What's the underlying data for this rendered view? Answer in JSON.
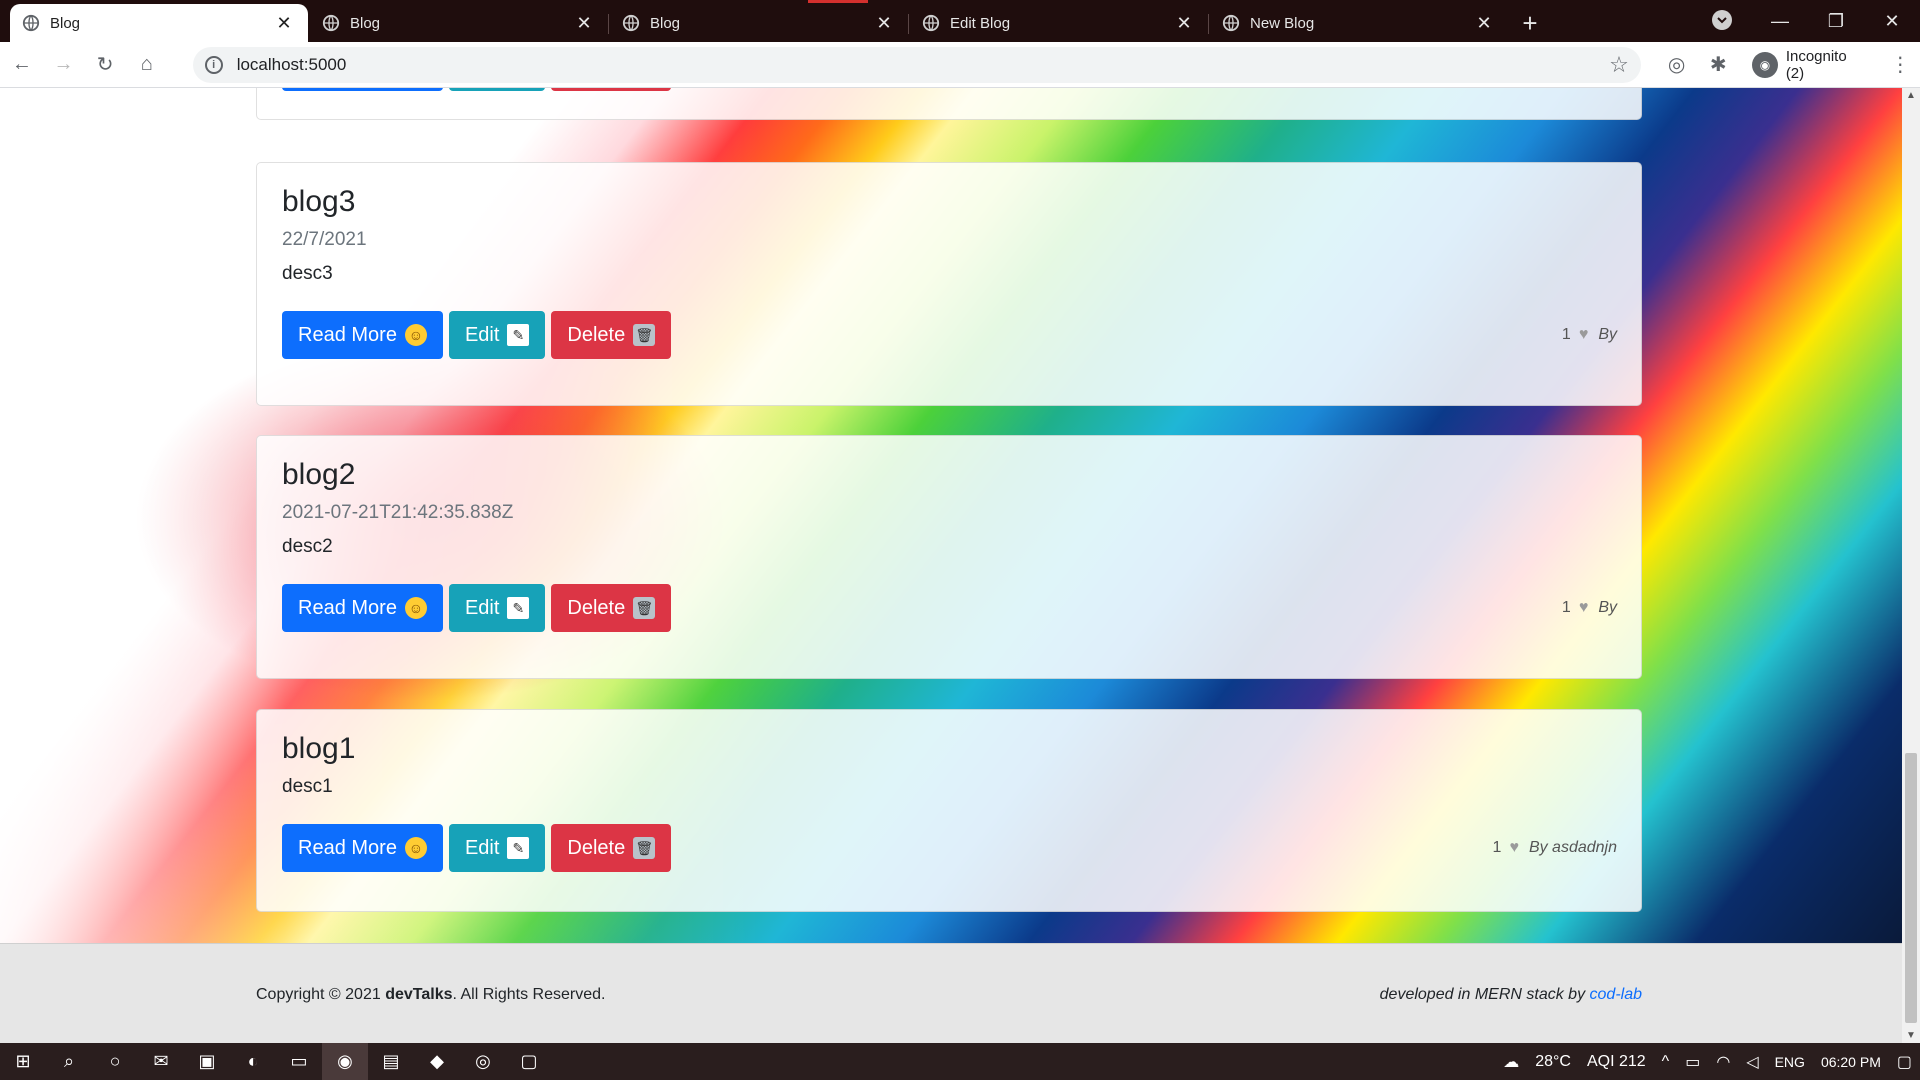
{
  "browser": {
    "tabs": [
      {
        "title": "Blog",
        "active": true
      },
      {
        "title": "Blog",
        "active": false
      },
      {
        "title": "Blog",
        "active": false
      },
      {
        "title": "Edit Blog",
        "active": false
      },
      {
        "title": "New Blog",
        "active": false
      }
    ],
    "new_tab_label": "+",
    "url": "localhost:5000",
    "incognito_label": "Incognito (2)"
  },
  "posts": [
    {
      "title": "blog3",
      "date": "22/7/2021",
      "desc": "desc3",
      "likes": "1",
      "by": "By"
    },
    {
      "title": "blog2",
      "date": "2021-07-21T21:42:35.838Z",
      "desc": "desc2",
      "likes": "1",
      "by": "By"
    },
    {
      "title": "blog1",
      "date": "",
      "desc": "desc1",
      "likes": "1",
      "by": "By asdadnjn"
    }
  ],
  "buttons": {
    "read_more": "Read More",
    "edit": "Edit",
    "delete": "Delete"
  },
  "footer": {
    "copyright_prefix": "Copyright © 2021 ",
    "brand": "devTalks",
    "copyright_suffix": ". All Rights Reserved.",
    "dev_prefix": "developed in MERN stack by ",
    "dev_link": "cod-lab"
  },
  "taskbar": {
    "weather": "28°C",
    "aqi": "AQI 212",
    "lang": "ENG",
    "time": "06:20 PM"
  },
  "colors": {
    "read_more": "#0d6efd",
    "edit": "#17a2b8",
    "delete": "#dc3545"
  }
}
